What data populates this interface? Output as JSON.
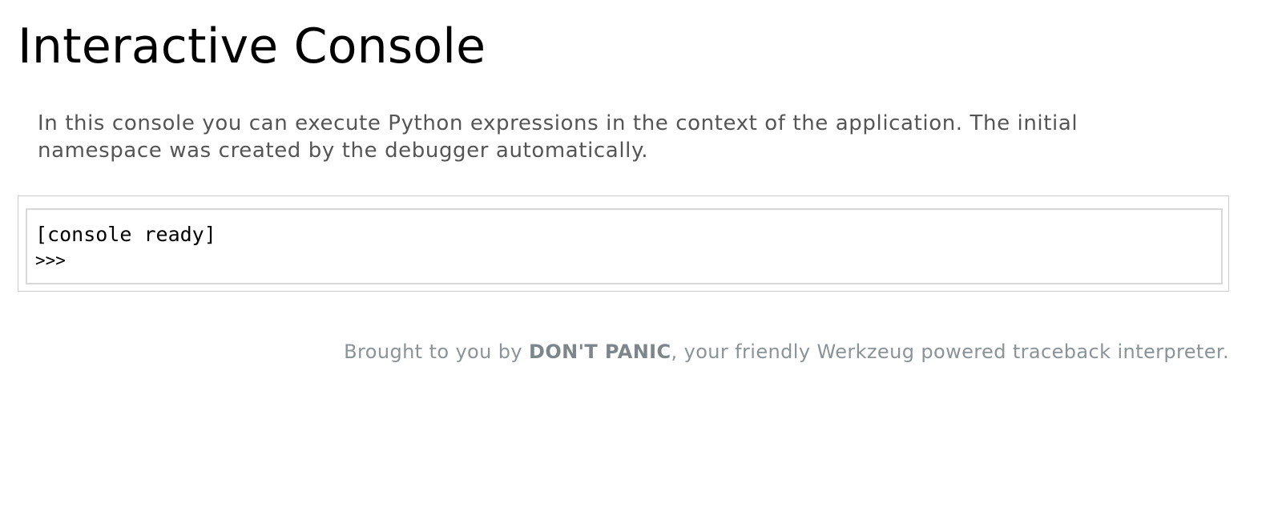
{
  "page": {
    "title": "Interactive Console"
  },
  "explanation": {
    "text": "In this console you can execute Python expressions in the context of the application. The initial namespace was created by the debugger automatically."
  },
  "console": {
    "output_line": "[console ready]",
    "prompt": ">>>",
    "input_value": ""
  },
  "footer": {
    "prefix": "Brought to you by ",
    "brand": "DON'T PANIC",
    "suffix": ", your friendly Werkzeug powered traceback interpreter."
  },
  "colors": {
    "explanation_text": "#555555",
    "footer_text": "#8a9498",
    "console_border": "#cccccc"
  }
}
